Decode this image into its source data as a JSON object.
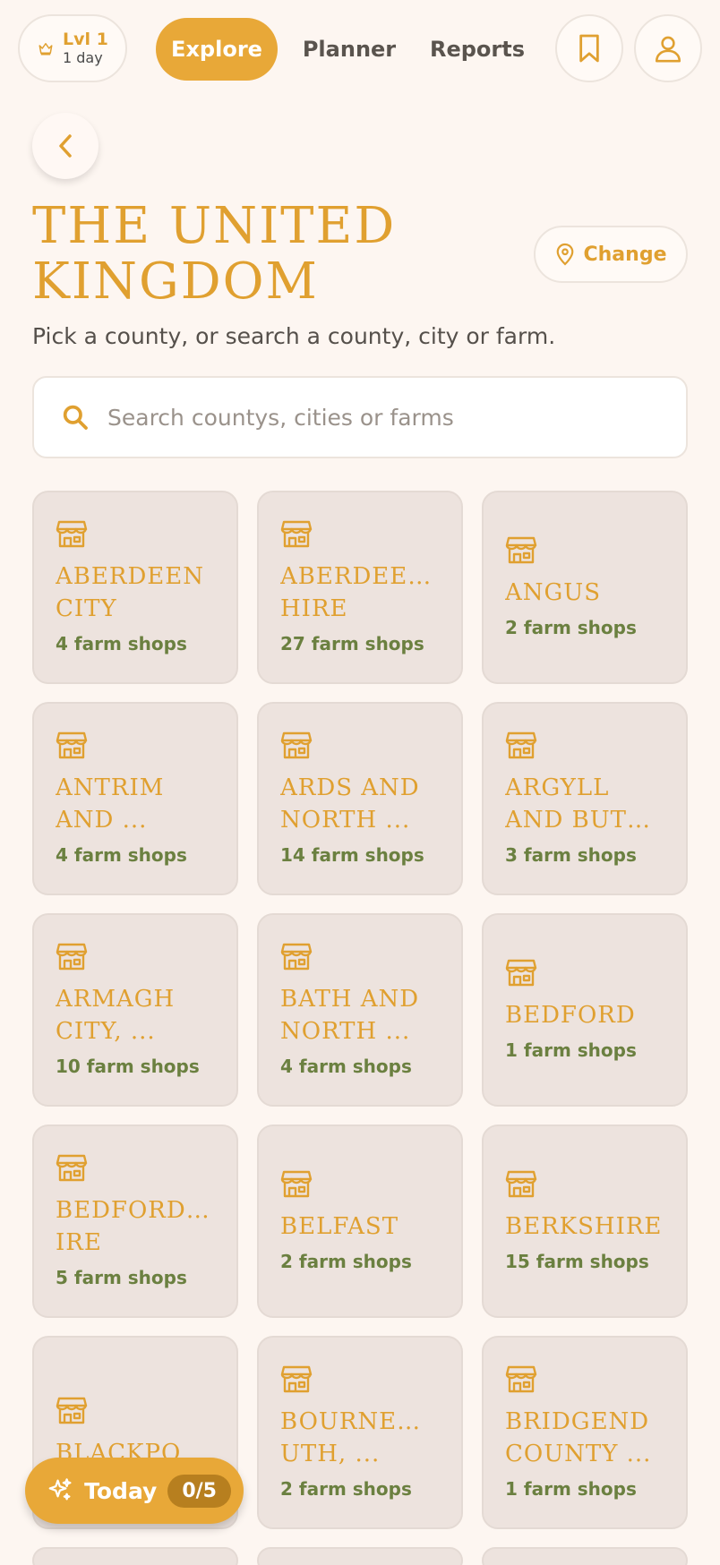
{
  "nav": {
    "level_label": "Lvl 1",
    "level_days": "1 day",
    "tabs": [
      {
        "label": "Explore",
        "active": true
      },
      {
        "label": "Planner",
        "active": false
      },
      {
        "label": "Reports",
        "active": false
      }
    ]
  },
  "header": {
    "title_line1": "THE UNITED",
    "title_line2": "KINGDOM",
    "change_label": "Change",
    "subtitle": "Pick a county, or search a county, city or farm."
  },
  "search": {
    "placeholder": "Search countys, cities or farms",
    "value": ""
  },
  "counties": [
    {
      "name_lines": [
        "ABERDEEN",
        "CITY"
      ],
      "count": "4 farm shops"
    },
    {
      "name_lines": [
        "ABERDEENS",
        "HIRE"
      ],
      "count": "27 farm shops"
    },
    {
      "name_lines": [
        "ANGUS"
      ],
      "count": "2 farm shops"
    },
    {
      "name_lines": [
        "ANTRIM",
        "AND ..."
      ],
      "count": "4 farm shops"
    },
    {
      "name_lines": [
        "ARDS AND",
        "NORTH ..."
      ],
      "count": "14 farm shops"
    },
    {
      "name_lines": [
        "ARGYLL",
        "AND BUTE..."
      ],
      "count": "3 farm shops"
    },
    {
      "name_lines": [
        "ARMAGH",
        "CITY, ..."
      ],
      "count": "10 farm shops"
    },
    {
      "name_lines": [
        "BATH AND",
        "NORTH ..."
      ],
      "count": "4 farm shops"
    },
    {
      "name_lines": [
        "BEDFORD"
      ],
      "count": "1 farm shops"
    },
    {
      "name_lines": [
        "BEDFORDSH",
        "IRE"
      ],
      "count": "5 farm shops"
    },
    {
      "name_lines": [
        "BELFAST"
      ],
      "count": "2 farm shops"
    },
    {
      "name_lines": [
        "BERKSHIRE"
      ],
      "count": "15 farm shops"
    },
    {
      "name_lines": [
        "BLACKPOOL"
      ],
      "count": ""
    },
    {
      "name_lines": [
        "BOURNEMO",
        "UTH, ..."
      ],
      "count": "2 farm shops"
    },
    {
      "name_lines": [
        "BRIDGEND",
        "COUNTY ..."
      ],
      "count": "1 farm shops"
    }
  ],
  "today": {
    "label": "Today",
    "progress": "0/5"
  },
  "colors": {
    "accent": "#e8a838",
    "title": "#e0a030",
    "count": "#6b8040",
    "card_bg": "#ede3de",
    "page_bg": "#fdf6f1"
  },
  "icons": {
    "level": "crown-icon",
    "bookmark": "bookmark-icon",
    "profile": "user-icon",
    "back": "chevron-left-icon",
    "change": "map-pin-icon",
    "search": "search-icon",
    "card": "shop-icon",
    "today": "sparkles-icon"
  }
}
